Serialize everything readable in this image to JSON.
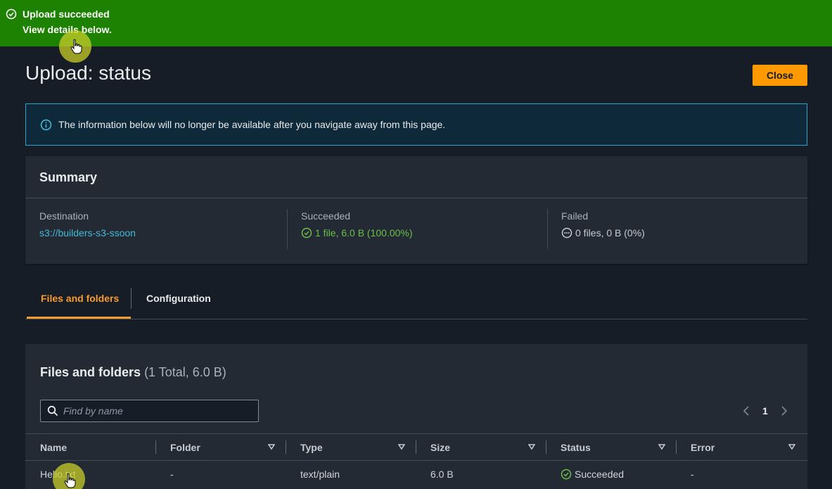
{
  "flash": {
    "title": "Upload succeeded",
    "subtitle": "View details below."
  },
  "page": {
    "title": "Upload: status",
    "close_label": "Close"
  },
  "info_alert": {
    "text": "The information below will no longer be available after you navigate away from this page."
  },
  "summary": {
    "heading": "Summary",
    "destination_label": "Destination",
    "destination_value": "s3://builders-s3-ssoon",
    "succeeded_label": "Succeeded",
    "succeeded_value": "1 file, 6.0 B (100.00%)",
    "failed_label": "Failed",
    "failed_value": "0 files, 0 B (0%)"
  },
  "tabs": [
    {
      "label": "Files and folders",
      "active": true
    },
    {
      "label": "Configuration",
      "active": false
    }
  ],
  "files": {
    "title": "Files and folders",
    "count": "(1 Total, 6.0 B)",
    "search_placeholder": "Find by name",
    "page_number": "1",
    "columns": [
      "Name",
      "Folder",
      "Type",
      "Size",
      "Status",
      "Error"
    ],
    "rows": [
      {
        "name": "Hello.txt",
        "folder": "-",
        "type": "text/plain",
        "size": "6.0 B",
        "status": "Succeeded",
        "error": "-"
      }
    ]
  },
  "colors": {
    "flash_bg": "#1d8102",
    "accent": "#ff9900",
    "link": "#44b9d6",
    "success": "#6dbf4b"
  }
}
